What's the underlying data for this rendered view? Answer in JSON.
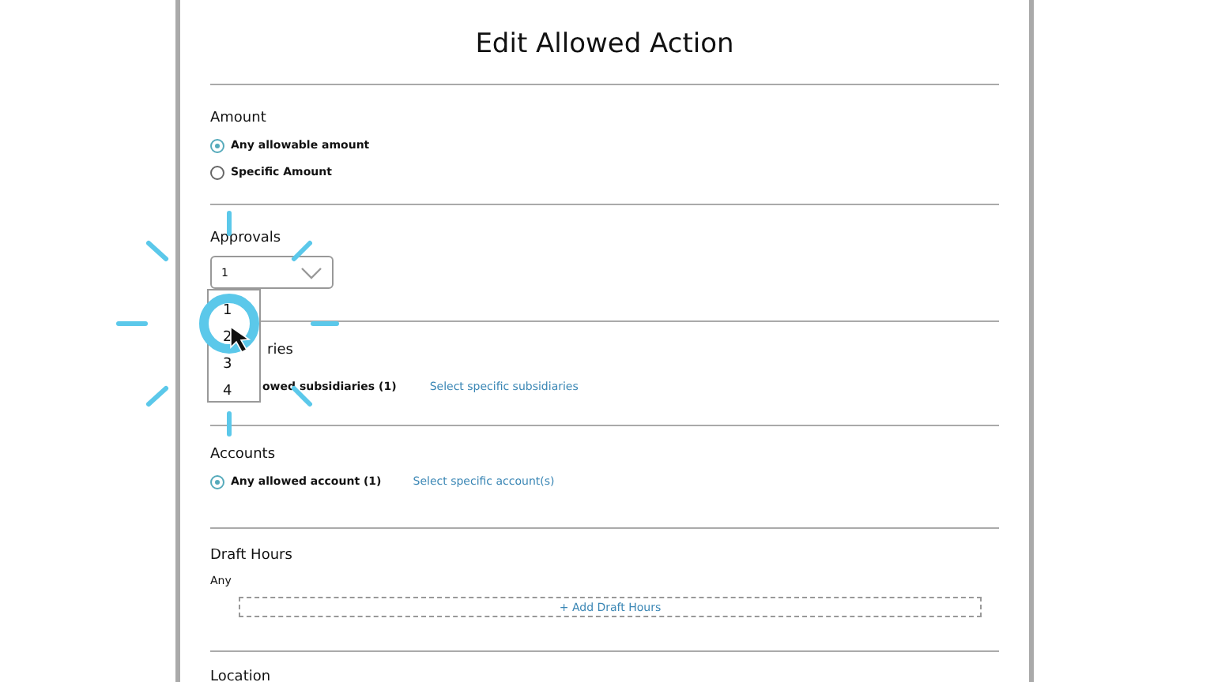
{
  "title": "Edit Allowed Action",
  "amount": {
    "heading": "Amount",
    "options": [
      {
        "label": "Any allowable amount",
        "selected": true
      },
      {
        "label": "Specific Amount",
        "selected": false
      }
    ]
  },
  "approvals": {
    "heading": "Approvals",
    "value": "1",
    "options": [
      "1",
      "2",
      "3",
      "4"
    ]
  },
  "subsidiaries": {
    "heading": "ries",
    "option_label": "owed subsidiaries (1)",
    "link": "Select specific subsidiaries"
  },
  "accounts": {
    "heading": "Accounts",
    "option": {
      "label": "Any allowed account (1)",
      "selected": true
    },
    "link": "Select specific account(s)"
  },
  "draft_hours": {
    "heading": "Draft Hours",
    "value": "Any",
    "add_button": "+ Add Draft Hours"
  },
  "location": {
    "heading": "Location"
  }
}
